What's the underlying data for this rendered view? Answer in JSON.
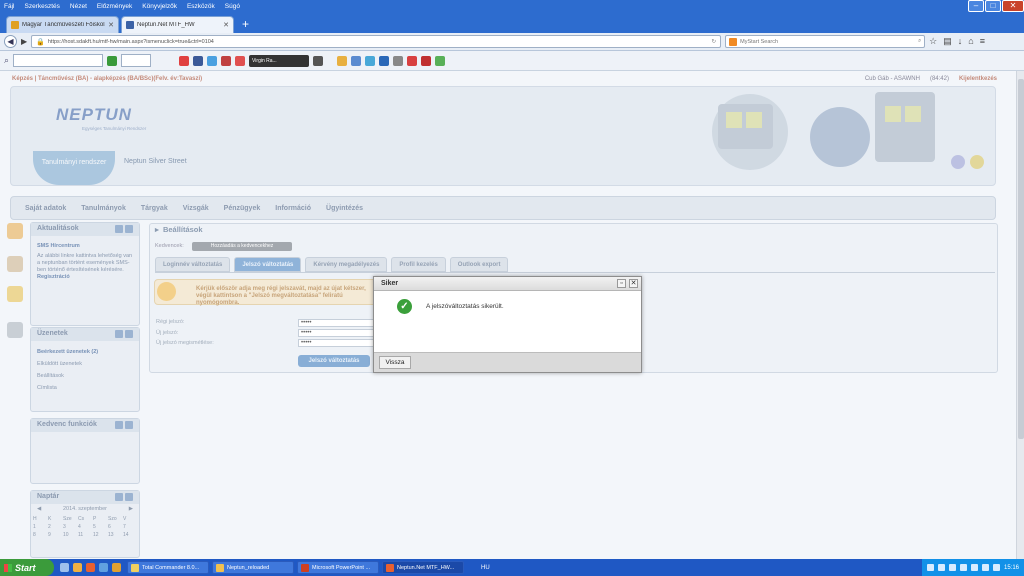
{
  "browser": {
    "menu": [
      "Fájl",
      "Szerkesztés",
      "Nézet",
      "Előzmények",
      "Könyvjelzők",
      "Eszközök",
      "Súgó"
    ],
    "tabs": [
      {
        "label": "Magyar Táncművészeti Főiskola",
        "active": false
      },
      {
        "label": "Neptun.Net MTF_HW",
        "active": true
      }
    ],
    "url": "https://host.sdakft.hu/mtf-hw/main.aspx?ismenuclick=true&ctrl=0104",
    "search_placeholder": "MyStart Search",
    "toolbar_player": "Virgin Ra..."
  },
  "page": {
    "topbar_left": "Képzés | Táncművész (BA) - alapképzés (BA/BSc)(Felv. év:Tavaszi)",
    "topbar_user": "Cub Gáb - ASAWNH",
    "topbar_time": "(84:42)",
    "topbar_logout": "Kijelentkezés",
    "logo": "NEPTUN",
    "logo_sub": "Egységes Tanulmányi Rendszer",
    "system_tab": "Tanulmányi rendszer",
    "system_name": "Neptun Silver Street",
    "mainnav": [
      "Saját adatok",
      "Tanulmányok",
      "Tárgyak",
      "Vizsgák",
      "Pénzügyek",
      "Információ",
      "Ügyintézés"
    ]
  },
  "sidebar": {
    "news": {
      "title": "Aktualitások",
      "heading": "SMS Hírcentrum",
      "text": "Az alábbi linkre kattintva lehetőség van a neptunban történt események SMS-ben történő értesítésének kérésére.",
      "link": "Regisztráció"
    },
    "messages": {
      "title": "Üzenetek",
      "items": [
        "Beérkezett üzenetek (2)",
        "Elküldött üzenetek",
        "Beállítások",
        "Címlista"
      ]
    },
    "favorites": {
      "title": "Kedvenc funkciók"
    },
    "calendar": {
      "title": "Naptár",
      "month": "2014. szeptember",
      "days": [
        "H",
        "K",
        "Sze",
        "Cs",
        "P",
        "Szo",
        "V"
      ],
      "rows": [
        [
          "1",
          "2",
          "3",
          "4",
          "5",
          "6",
          "7"
        ],
        [
          "8",
          "9",
          "10",
          "11",
          "12",
          "13",
          "14"
        ]
      ]
    }
  },
  "content": {
    "title": "Beállítások",
    "favorites_label": "Kedvencek:",
    "favorites_button": "Hozzáadás a kedvencekhez",
    "tabs": [
      "Loginnév változtatás",
      "Jelszó változtatás",
      "Kérvény megadélyezés",
      "Profil kezelés",
      "Outlook export"
    ],
    "active_tab": 1,
    "warning": "Kérjük először adja meg régi jelszavát, majd az újat kétszer, végül kattintson a \"Jelszó megváltoztatása\" feliratú nyomógombra.",
    "fields": [
      {
        "label": "Régi jelszó:",
        "value": "•••••"
      },
      {
        "label": "Új jelszó:",
        "value": "•••••"
      },
      {
        "label": "Új jelszó megismétlése:",
        "value": "•••••"
      }
    ],
    "submit": "Jelszó változtatás"
  },
  "dialog": {
    "title": "Siker",
    "message": "A jelszóváltoztatás sikerült.",
    "button": "Vissza"
  },
  "taskbar": {
    "start": "Start",
    "windows": [
      "Total Commander 8.0...",
      "Neptun_reloaded",
      "Microsoft PowerPoint ...",
      "Neptun.Net MTF_HW..."
    ],
    "lang": "HU",
    "clock": "15:16"
  },
  "colors": {
    "accent": "#2d6ccf",
    "success": "#3ba03b",
    "taskbar": "#1f58c4"
  }
}
